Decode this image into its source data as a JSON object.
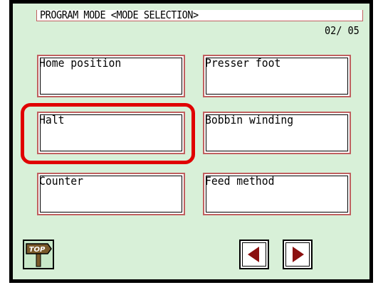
{
  "header": {
    "title": "PROGRAM MODE <MODE SELECTION>",
    "page_indicator": "02/ 05"
  },
  "mode_buttons": [
    {
      "label": "Home position"
    },
    {
      "label": "Presser foot"
    },
    {
      "label": "Halt"
    },
    {
      "label": "Bobbin winding"
    },
    {
      "label": "Counter"
    },
    {
      "label": "Feed method"
    }
  ],
  "footer": {
    "top_icon_text": "TOP",
    "prev_icon": "arrow-left-icon",
    "next_icon": "arrow-right-icon"
  },
  "colors": {
    "background": "#d8f0d8",
    "button_border": "#c06060",
    "highlight": "#e00000",
    "arrow": "#8b1010",
    "top_sign": "#7a5a2a"
  }
}
